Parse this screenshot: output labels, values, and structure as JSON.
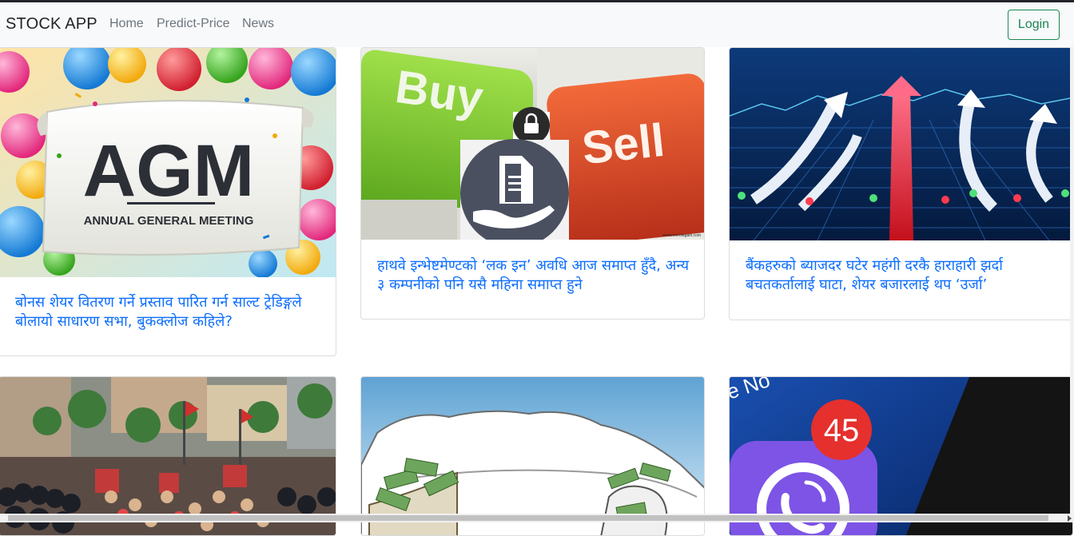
{
  "navbar": {
    "brand": "STOCK APP",
    "links": [
      "Home",
      "Predict-Price",
      "News"
    ],
    "login_label": "Login"
  },
  "cards": [
    {
      "image": "agm-balloons-image",
      "image_text": {
        "big": "AGM",
        "sub": "ANNUAL GENERAL MEETING"
      },
      "title": "बोनस शेयर वितरण गर्ने प्रस्ताव पारित गर्न साल्ट ट्रेडिङ्गले बोलायो साधारण सभा, बुकक्लोज कहिले?"
    },
    {
      "image": "buy-sell-keys-image",
      "image_text": {
        "left": "Buy",
        "right": "Sell",
        "credit": "www.merolagani.com"
      },
      "title": "हाथवे इन्भेष्टमेण्टको ‘लक इन’ अवधि आज समाप्त हुँदै, अन्य ३ कम्पनीको पनि यसै महिना समाप्त हुने"
    },
    {
      "image": "rising-arrows-image",
      "title": "बैंकहरुको ब्याजदर घटेर महंगी दरकै हाराहारी झर्दा बचतकर्तालाई घाटा, शेयर बजारलाई थप ‘उर्जा’"
    },
    {
      "image": "protest-crowd-image",
      "title": ""
    },
    {
      "image": "money-map-image",
      "title": ""
    },
    {
      "image": "viber-notification-image",
      "image_text": {
        "badge": "45",
        "corner": "e No"
      },
      "title": ""
    }
  ],
  "colors": {
    "accent": "#0d6efd",
    "login": "#198754",
    "navbar_bg": "#f8f9fa"
  }
}
